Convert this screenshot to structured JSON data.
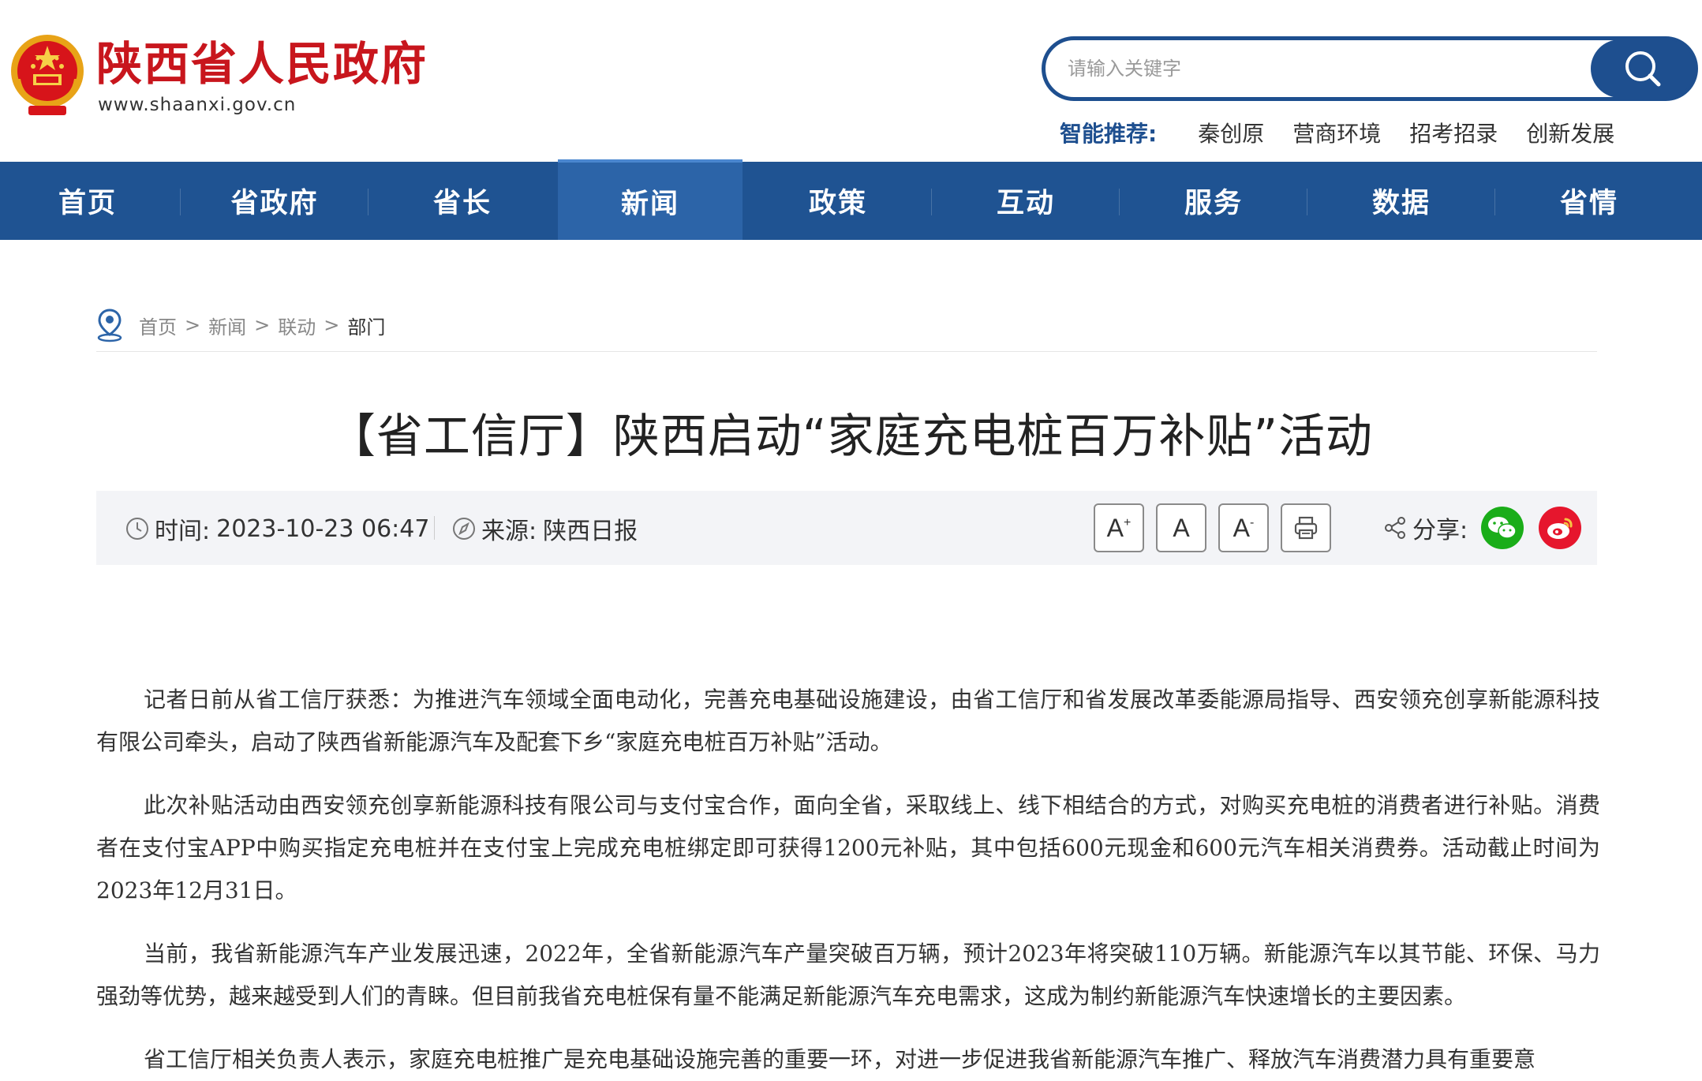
{
  "header": {
    "site_title": "陕西省人民政府",
    "site_url": "www.shaanxi.gov.cn",
    "search_placeholder": "请输入关键字",
    "recommend_label": "智能推荐:",
    "recommend_items": [
      "秦创原",
      "营商环境",
      "招考招录",
      "创新发展"
    ]
  },
  "nav": {
    "items": [
      "首页",
      "省政府",
      "省长",
      "新闻",
      "政策",
      "互动",
      "服务",
      "数据",
      "省情"
    ],
    "active_index": 3
  },
  "breadcrumb": {
    "items": [
      "首页",
      "新闻",
      "联动",
      "部门"
    ],
    "separator": ">"
  },
  "article": {
    "title": "【省工信厅】陕西启动“家庭充电桩百万补贴”活动",
    "time_label": "时间:",
    "time_value": "2023-10-23 06:47",
    "source_label": "来源:",
    "source_value": "陕西日报",
    "font_buttons": {
      "larger": "A",
      "larger_sup": "+",
      "normal": "A",
      "smaller": "A",
      "smaller_sup": "-"
    },
    "share_label": "分享:",
    "paragraphs": [
      "记者日前从省工信厅获悉：为推进汽车领域全面电动化，完善充电基础设施建设，由省工信厅和省发展改革委能源局指导、西安领充创享新能源科技有限公司牵头，启动了陕西省新能源汽车及配套下乡“家庭充电桩百万补贴”活动。",
      "此次补贴活动由西安领充创享新能源科技有限公司与支付宝合作，面向全省，采取线上、线下相结合的方式，对购买充电桩的消费者进行补贴。消费者在支付宝APP中购买指定充电桩并在支付宝上完成充电桩绑定即可获得1200元补贴，其中包括600元现金和600元汽车相关消费券。活动截止时间为2023年12月31日。",
      "当前，我省新能源汽车产业发展迅速，2022年，全省新能源汽车产量突破百万辆，预计2023年将突破110万辆。新能源汽车以其节能、环保、马力强劲等优势，越来越受到人们的青睐。但目前我省充电桩保有量不能满足新能源汽车充电需求，这成为制约新能源汽车快速增长的主要因素。",
      "省工信厅相关负责人表示，家庭充电桩推广是充电基础设施完善的重要一环，对进一步促进我省新能源汽车推广、释放汽车消费潜力具有重要意"
    ]
  },
  "colors": {
    "brand_red": "#c8161d",
    "nav_blue": "#1f5392",
    "nav_active": "#2c64a8",
    "search_blue": "#1e4f8f",
    "wechat_green": "#1aad19",
    "weibo_red": "#e6162d"
  },
  "icons": {
    "emblem": "national-emblem-icon",
    "search": "search-icon",
    "location": "location-pin-icon",
    "clock": "clock-icon",
    "source": "compass-icon",
    "print": "printer-icon",
    "share": "share-icon",
    "wechat": "wechat-icon",
    "weibo": "weibo-icon"
  }
}
